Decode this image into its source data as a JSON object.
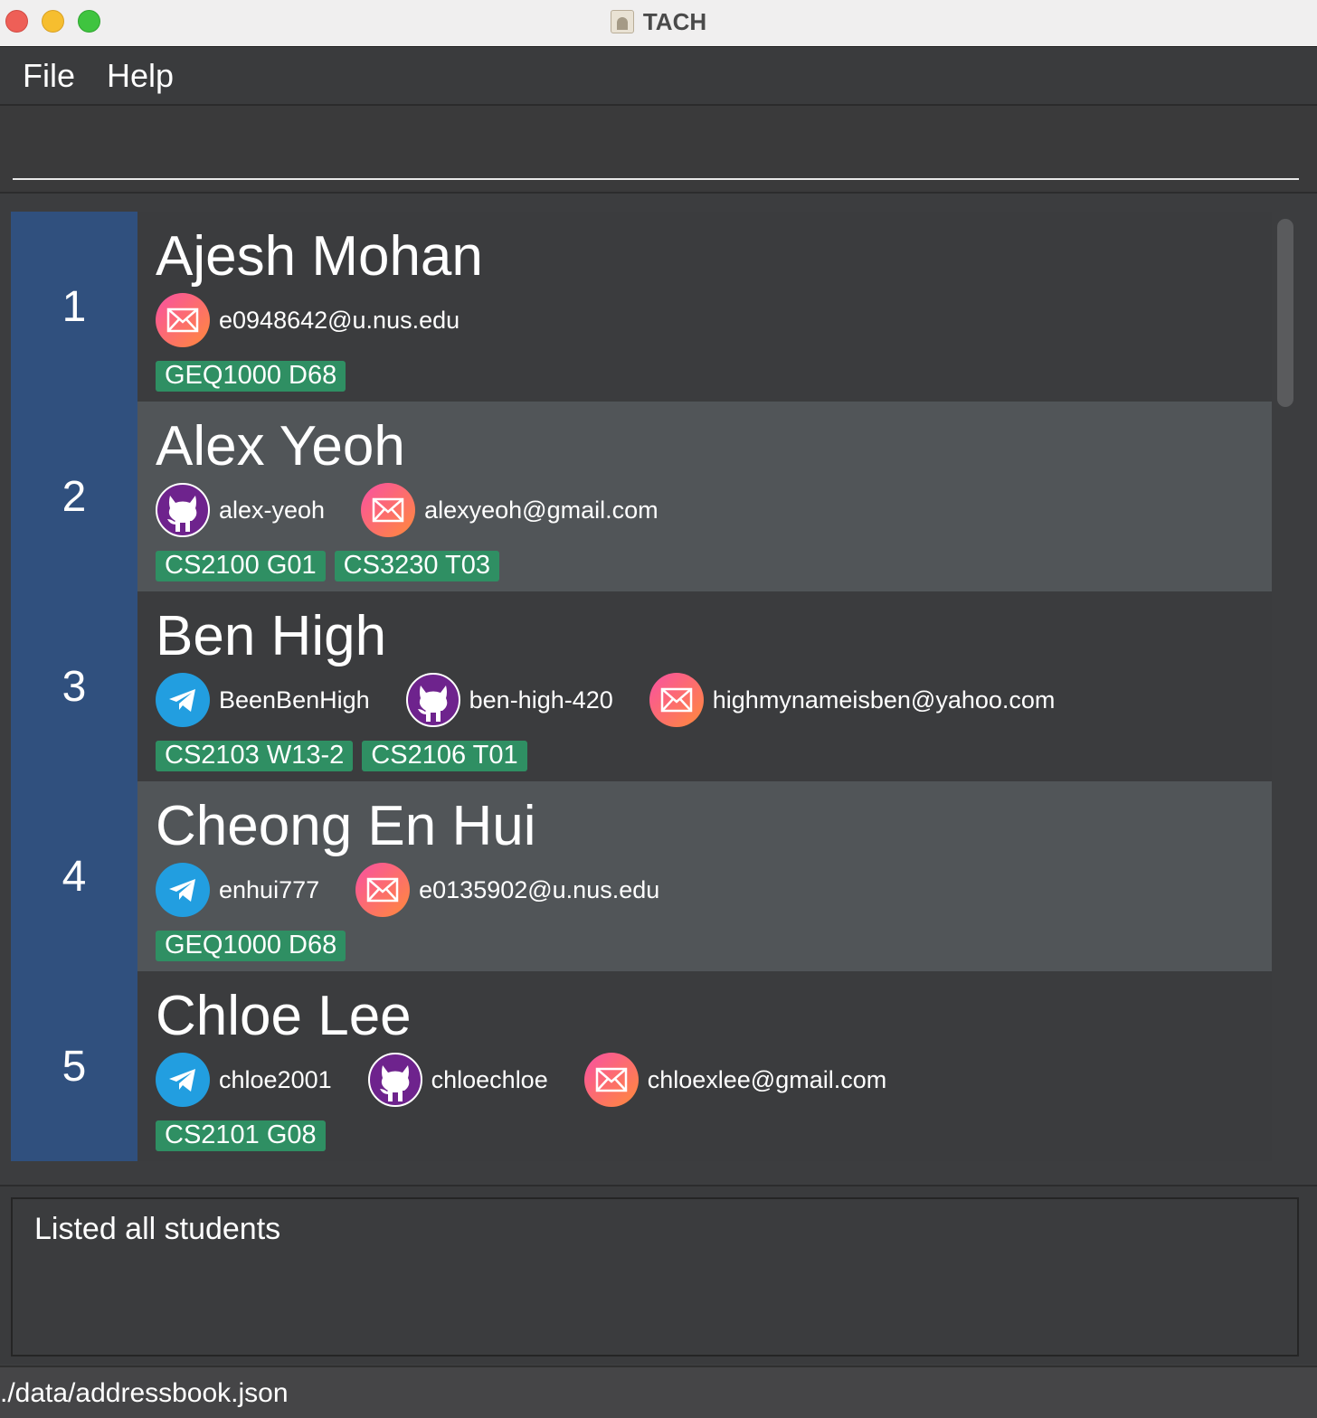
{
  "window": {
    "title": "TACH"
  },
  "menu": {
    "file": "File",
    "help": "Help"
  },
  "command": {
    "value": "",
    "placeholder": ""
  },
  "students": [
    {
      "index": "1",
      "name": "Ajesh Mohan",
      "contacts": [
        {
          "type": "email",
          "icon": "email-icon",
          "value": "e0948642@u.nus.edu"
        }
      ],
      "tags": [
        "GEQ1000 D68"
      ]
    },
    {
      "index": "2",
      "name": "Alex Yeoh",
      "contacts": [
        {
          "type": "github",
          "icon": "github-icon",
          "value": "alex-yeoh"
        },
        {
          "type": "email",
          "icon": "email-icon",
          "value": "alexyeoh@gmail.com"
        }
      ],
      "tags": [
        "CS2100 G01",
        "CS3230 T03"
      ]
    },
    {
      "index": "3",
      "name": "Ben High",
      "contacts": [
        {
          "type": "telegram",
          "icon": "telegram-icon",
          "value": "BeenBenHigh"
        },
        {
          "type": "github",
          "icon": "github-icon",
          "value": "ben-high-420"
        },
        {
          "type": "email",
          "icon": "email-icon",
          "value": "highmynameisben@yahoo.com"
        }
      ],
      "tags": [
        "CS2103 W13-2",
        "CS2106 T01"
      ]
    },
    {
      "index": "4",
      "name": "Cheong En Hui",
      "contacts": [
        {
          "type": "telegram",
          "icon": "telegram-icon",
          "value": "enhui777"
        },
        {
          "type": "email",
          "icon": "email-icon",
          "value": "e0135902@u.nus.edu"
        }
      ],
      "tags": [
        "GEQ1000 D68"
      ]
    },
    {
      "index": "5",
      "name": "Chloe Lee",
      "contacts": [
        {
          "type": "telegram",
          "icon": "telegram-icon",
          "value": "chloe2001"
        },
        {
          "type": "github",
          "icon": "github-icon",
          "value": "chloechloe"
        },
        {
          "type": "email",
          "icon": "email-icon",
          "value": "chloexlee@gmail.com"
        }
      ],
      "tags": [
        "CS2101 G08"
      ]
    }
  ],
  "result": {
    "message": "Listed all students"
  },
  "status": {
    "file_path": "./data/addressbook.json"
  },
  "colors": {
    "index_bg": "#30507e",
    "tag_bg": "#2f8f63",
    "telegram": "#229ee0",
    "github": "#6e238d",
    "email_start": "#f950a3",
    "email_end": "#ff8a3a"
  }
}
